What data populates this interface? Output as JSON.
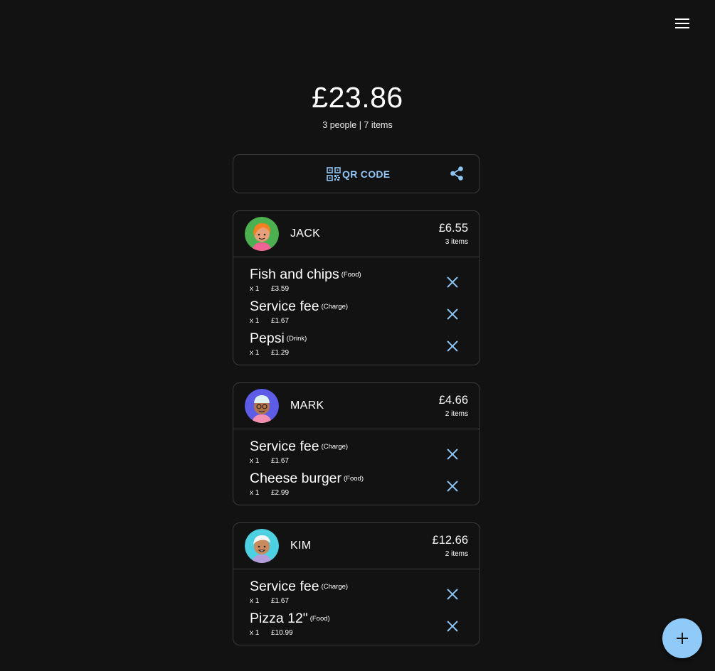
{
  "header": {
    "menu_icon": "hamburger-menu-icon"
  },
  "summary": {
    "total": "£23.86",
    "details": "3 people | 7 items"
  },
  "actions": {
    "qr_label": "QR CODE",
    "qr_icon": "qr-code-icon",
    "share_icon": "share-icon"
  },
  "colors": {
    "background": "#121212",
    "accent": "#90caf9",
    "border": "#3a3a3a"
  },
  "people": [
    {
      "name": "JACK",
      "total": "£6.55",
      "count": "3 items",
      "avatar_color": "#4caf50",
      "items": [
        {
          "name": "Fish and chips",
          "category": "(Food)",
          "qty": "x 1",
          "price": "£3.59"
        },
        {
          "name": "Service fee",
          "category": "(Charge)",
          "qty": "x 1",
          "price": "£1.67"
        },
        {
          "name": "Pepsi",
          "category": "(Drink)",
          "qty": "x 1",
          "price": "£1.29"
        }
      ]
    },
    {
      "name": "MARK",
      "total": "£4.66",
      "count": "2 items",
      "avatar_color": "#5c5ce6",
      "items": [
        {
          "name": "Service fee",
          "category": "(Charge)",
          "qty": "x 1",
          "price": "£1.67"
        },
        {
          "name": "Cheese burger",
          "category": "(Food)",
          "qty": "x 1",
          "price": "£2.99"
        }
      ]
    },
    {
      "name": "KIM",
      "total": "£12.66",
      "count": "2 items",
      "avatar_color": "#4dd0e1",
      "items": [
        {
          "name": "Service fee",
          "category": "(Charge)",
          "qty": "x 1",
          "price": "£1.67"
        },
        {
          "name": "Pizza 12\"",
          "category": "(Food)",
          "qty": "x 1",
          "price": "£10.99"
        }
      ]
    }
  ],
  "fab": {
    "icon": "plus-icon"
  }
}
